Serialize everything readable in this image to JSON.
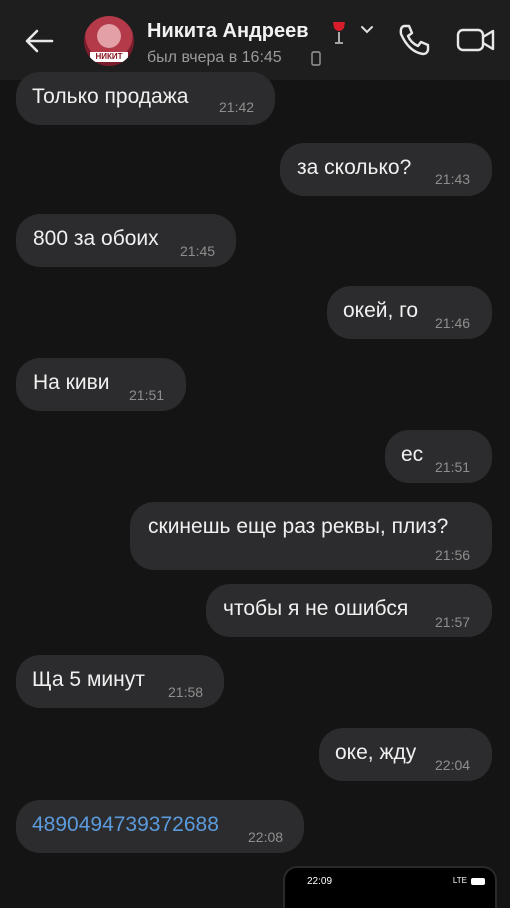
{
  "header": {
    "contact_name": "Никита Андреев",
    "status": "был вчера в 16:45",
    "avatar_badge": "НИКИТ",
    "icons": {
      "back": "arrow-left-icon",
      "wine": "wine-glass-icon",
      "expand": "chevron-down-icon",
      "phone_status": "mobile-phone-icon",
      "call": "phone-icon",
      "video": "video-camera-icon"
    }
  },
  "messages": [
    {
      "side": "in",
      "text": "Только продажа",
      "time": "21:42"
    },
    {
      "side": "out",
      "text": "за сколько?",
      "time": "21:43"
    },
    {
      "side": "in",
      "text": "800 за обоих",
      "time": "21:45"
    },
    {
      "side": "out",
      "text": "окей, го",
      "time": "21:46"
    },
    {
      "side": "in",
      "text": "На киви",
      "time": "21:51"
    },
    {
      "side": "out",
      "text": "ес",
      "time": "21:51"
    },
    {
      "side": "out",
      "text": "скинешь еще раз реквы, плиз?",
      "time": "21:56"
    },
    {
      "side": "out",
      "text": "чтобы я не ошибся",
      "time": "21:57"
    },
    {
      "side": "in",
      "text": "Ща 5 минут",
      "time": "21:58"
    },
    {
      "side": "out",
      "text": "оке, жду",
      "time": "22:04"
    },
    {
      "side": "in",
      "text": "4890494739372688",
      "time": "22:08",
      "link": true
    }
  ],
  "screenshot_preview": {
    "time": "22:09",
    "signal": "LTE"
  },
  "colors": {
    "background": "#141414",
    "header": "#1e1e1e",
    "bubble": "#2c2c2e",
    "link": "#5b9bdc",
    "time": "#8e8e8e"
  }
}
